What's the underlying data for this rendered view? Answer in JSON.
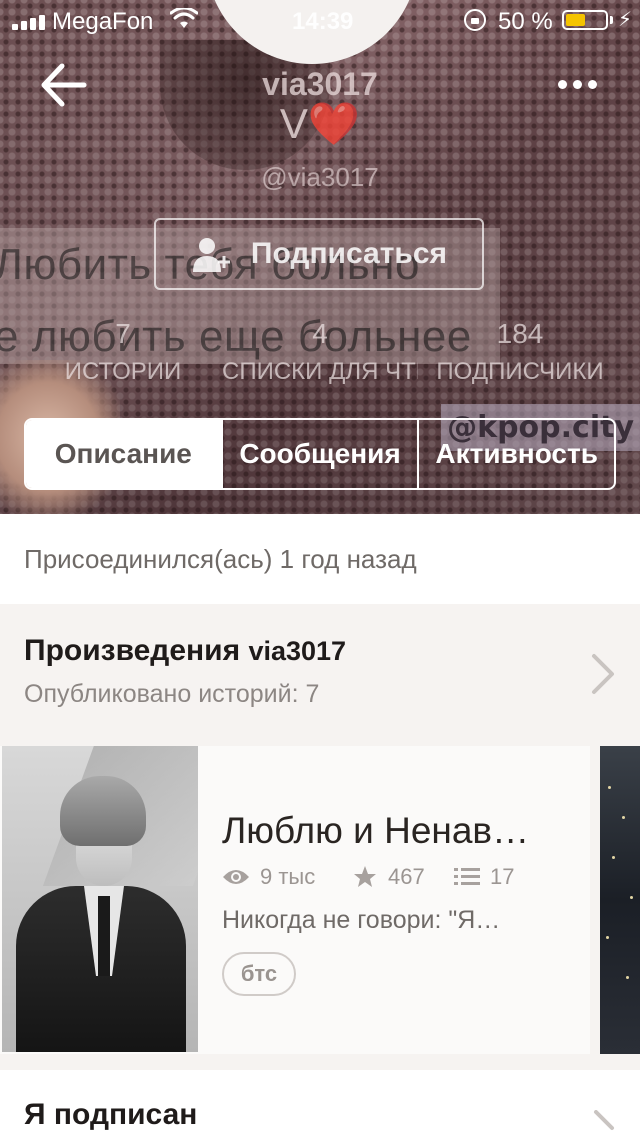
{
  "status_bar": {
    "carrier": "MegaFon",
    "time": "14:39",
    "battery_percent": "50 %",
    "battery_level": 0.5
  },
  "profile": {
    "username": "via3017",
    "display_name": "V❤️",
    "handle": "@via3017",
    "follow_label": "Подписаться"
  },
  "background_text": {
    "line1": "Любить тебя больно",
    "line2": "е любить еще больнее",
    "watermark": "@kpop.city"
  },
  "stats": [
    {
      "value": "7",
      "label": "ИСТОРИИ"
    },
    {
      "value": "4",
      "label": "СПИСКИ ДЛЯ ЧТЕНИЯ"
    },
    {
      "value": "184",
      "label": "ПОДПИСЧИКИ"
    }
  ],
  "tabs": [
    {
      "label": "Описание",
      "active": true
    },
    {
      "label": "Сообщения",
      "active": false
    },
    {
      "label": "Активность",
      "active": false
    }
  ],
  "about": {
    "joined": "Присоединился(ась) 1 год назад"
  },
  "works": {
    "title_prefix": "Произведения",
    "title_user": "via3017",
    "published": "Опубликовано историй: 7",
    "story": {
      "title": "Люблю и Ненав…",
      "reads": "9 тыс",
      "votes": "467",
      "parts": "17",
      "description": "Никогда не говори: \"Я…",
      "tag": "бтс"
    }
  },
  "following": {
    "title": "Я подписан"
  },
  "colors": {
    "accent_battery": "#f5c400",
    "active_tab_bg": "#ffffff",
    "section_bg": "#f6f3f1"
  }
}
